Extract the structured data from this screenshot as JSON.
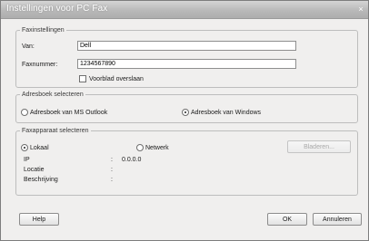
{
  "window": {
    "title": "Instellingen voor PC Fax",
    "close_glyph": "×"
  },
  "fax_settings": {
    "legend": "Faxinstellingen",
    "from_label": "Van:",
    "from_value": "Dell",
    "fax_number_label": "Faxnummer:",
    "fax_number_value": "1234567890",
    "skip_cover_label": "Voorblad overslaan",
    "skip_cover_checked": false
  },
  "address_book": {
    "legend": "Adresboek selecteren",
    "options": [
      {
        "label": "Adresboek van MS Outlook",
        "selected": false
      },
      {
        "label": "Adresboek van Windows",
        "selected": true
      }
    ]
  },
  "fax_device": {
    "legend": "Faxapparaat selecteren",
    "options": [
      {
        "label": "Lokaal",
        "selected": true
      },
      {
        "label": "Netwerk",
        "selected": false
      }
    ],
    "browse_label": "Bladeren...",
    "ip_label": "IP",
    "ip_value": "0.0.0.0",
    "location_label": "Locatie",
    "location_value": "",
    "description_label": "Beschrijving",
    "description_value": "",
    "separator": ":"
  },
  "buttons": {
    "help": "Help",
    "ok": "OK",
    "cancel": "Annuleren"
  }
}
